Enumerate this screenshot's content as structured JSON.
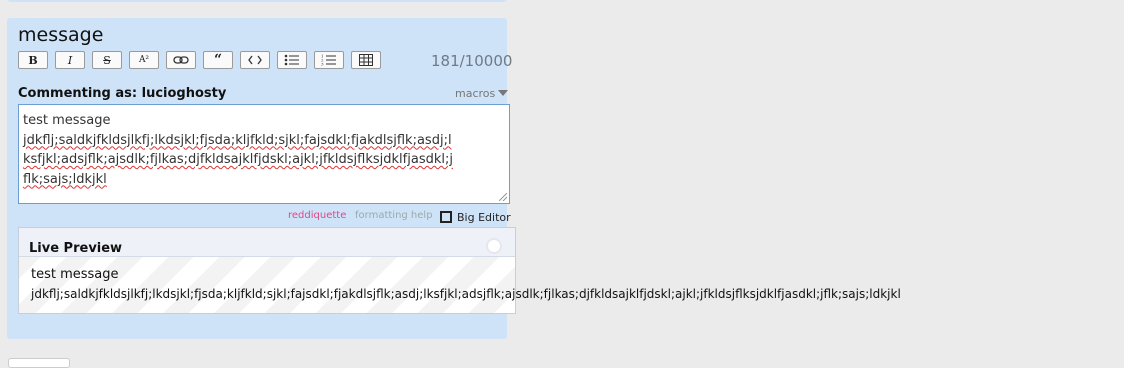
{
  "form": {
    "title": "message",
    "counter": "181/10000",
    "commenting_as": "Commenting as: lucioghosty",
    "macros_label": "macros",
    "editor_lines": [
      "test message",
      "jdkflj;saldkjfkldsjlkfj;lkdsjkl;fjsda;kljfkld;sjkl;fajsdkl;fjakdlsjflk;asdj;l",
      "ksfjkl;adsjflk;ajsdlk;fjlkas;djfkldsajklfjdskl;ajkl;jfkldsjflksjdklfjasdkl;j",
      "flk;sajs;ldkjkl"
    ],
    "reddiquette": "reddiquette",
    "formatting_help": "formatting help",
    "big_editor": "Big Editor"
  },
  "toolbar": [
    {
      "name": "bold-button",
      "glyph": "B"
    },
    {
      "name": "italic-button",
      "glyph": "I"
    },
    {
      "name": "strikethrough-button",
      "glyph": "S"
    },
    {
      "name": "superscript-button",
      "glyph": "A²"
    },
    {
      "name": "link-button",
      "glyph": "link-icon"
    },
    {
      "name": "quote-button",
      "glyph": "“"
    },
    {
      "name": "code-button",
      "glyph": "<>"
    },
    {
      "name": "bulleted-list-button",
      "glyph": "bullet-list-icon"
    },
    {
      "name": "numbered-list-button",
      "glyph": "numbered-list-icon"
    },
    {
      "name": "table-button",
      "glyph": "table-icon"
    }
  ],
  "preview": {
    "title": "Live Preview",
    "line1": "test message",
    "line2": "jdkflj;saldkjfkldsjlkfj;lkdsjkl;fjsda;kljfkld;sjkl;fajsdkl;fjakdlsjflk;asdj;lksfjkl;adsjflk;ajsdlk;fjlkas;djfkldsajklfjdskl;ajkl;jfkldsjflksjdklfjasdkl;jflk;sajs;ldkjkl"
  }
}
